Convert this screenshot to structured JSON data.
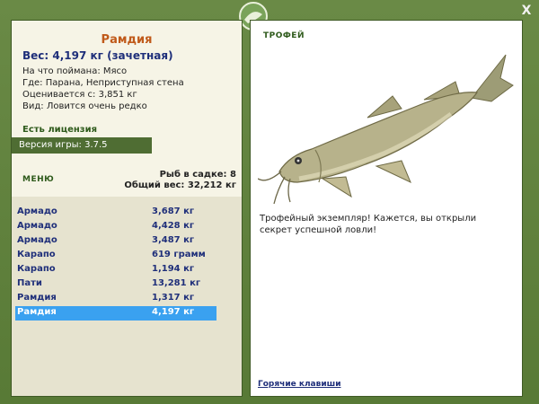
{
  "window": {
    "close_label": "X"
  },
  "fish": {
    "title": "Рамдия",
    "weight_line": "Вес: 4,197 кг (зачетная)",
    "info": [
      "На что поймана: Мясо",
      "Где: Парана, Неприступная стена",
      "Оценивается с: 3,851 кг",
      "Вид: Ловится очень редко"
    ]
  },
  "license": "Есть лицензия",
  "version": "Версия игры: 3.7.5",
  "menu_label": "МЕНЮ",
  "keepnet": {
    "count_line": "Рыб в садке: 8",
    "total_line": "Общий вес: 32,212 кг"
  },
  "catches": [
    {
      "name": "Армадо",
      "weight": "3,687 кг"
    },
    {
      "name": "Армадо",
      "weight": "4,428 кг"
    },
    {
      "name": "Армадо",
      "weight": "3,487 кг"
    },
    {
      "name": "Карапо",
      "weight": "619 грамм"
    },
    {
      "name": "Карапо",
      "weight": "1,194 кг"
    },
    {
      "name": "Пати",
      "weight": "13,281 кг"
    },
    {
      "name": "Рамдия",
      "weight": "1,317 кг"
    },
    {
      "name": "Рамдия",
      "weight": "4,197 кг"
    }
  ],
  "trophy": {
    "label": "ТРОФЕЙ",
    "text": "Трофейный экземпляр! Кажется, вы открыли секрет успешной ловли!"
  },
  "hotkeys_label": "Горячие клавиши",
  "colors": {
    "frame": "#5f7d3f",
    "accent_orange": "#c05a1a",
    "text_blue": "#1f2f7a",
    "selected_row": "#3aa1f0"
  }
}
